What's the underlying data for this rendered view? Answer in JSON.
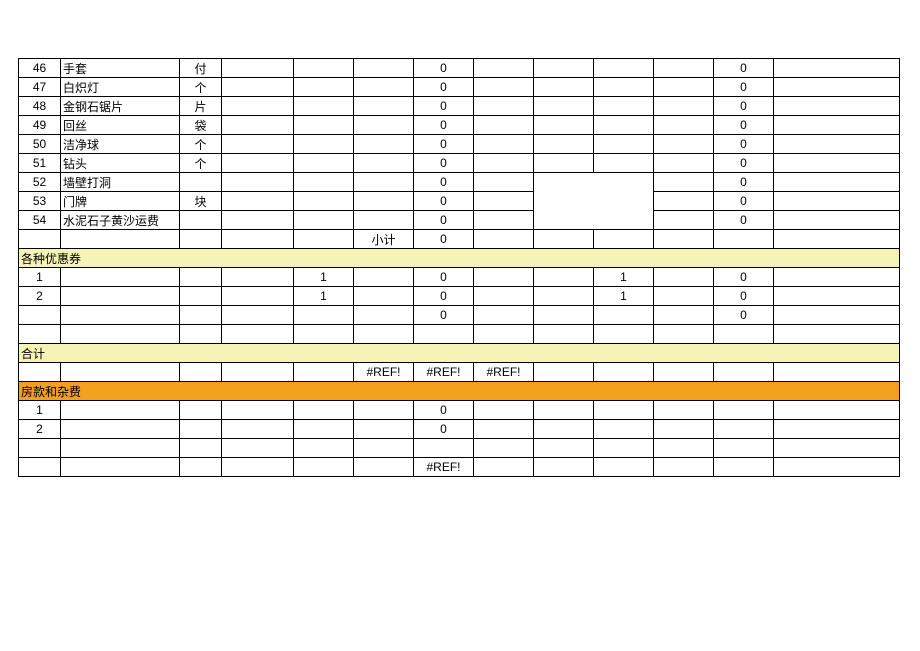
{
  "rows_items": [
    {
      "no": "46",
      "name": "手套",
      "unit": "付",
      "v6": "0",
      "v11": "0"
    },
    {
      "no": "47",
      "name": "白炽灯",
      "unit": "个",
      "v6": "0",
      "v11": "0"
    },
    {
      "no": "48",
      "name": "金钢石锯片",
      "unit": "片",
      "v6": "0",
      "v11": "0"
    },
    {
      "no": "49",
      "name": "回丝",
      "unit": "袋",
      "v6": "0",
      "v11": "0"
    },
    {
      "no": "50",
      "name": "洁净球",
      "unit": "个",
      "v6": "0",
      "v11": "0"
    },
    {
      "no": "51",
      "name": "钻头",
      "unit": "个",
      "v6": "0",
      "v11": "0"
    },
    {
      "no": "52",
      "name": "墙壁打洞",
      "unit": "",
      "v6": "0",
      "v11": "0",
      "merge_start": true
    },
    {
      "no": "53",
      "name": "门牌",
      "unit": "块",
      "v6": "0",
      "v11": "0",
      "merge_mid": true
    },
    {
      "no": "54",
      "name": "水泥石子黄沙运费",
      "unit": "",
      "v6": "0",
      "v11": "0",
      "merge_end": true
    }
  ],
  "subtotal": {
    "label": "小计",
    "v6": "0"
  },
  "section_coupon": {
    "title": "各种优惠券"
  },
  "coupon_rows": [
    {
      "no": "1",
      "v4": "1",
      "v6": "0",
      "v9": "1",
      "v11": "0"
    },
    {
      "no": "2",
      "v4": "1",
      "v6": "0",
      "v9": "1",
      "v11": "0"
    },
    {
      "no": "",
      "v4": "",
      "v6": "0",
      "v9": "",
      "v11": "0"
    }
  ],
  "section_total": {
    "title": "合计"
  },
  "total_row": {
    "v5": "#REF!",
    "v6": "#REF!",
    "v7": "#REF!"
  },
  "section_housing": {
    "title": "房款和杂费"
  },
  "housing_rows": [
    {
      "no": "1",
      "v6": "0"
    },
    {
      "no": "2",
      "v6": "0"
    },
    {
      "no": ""
    }
  ],
  "housing_total": {
    "v6": "#REF!"
  }
}
